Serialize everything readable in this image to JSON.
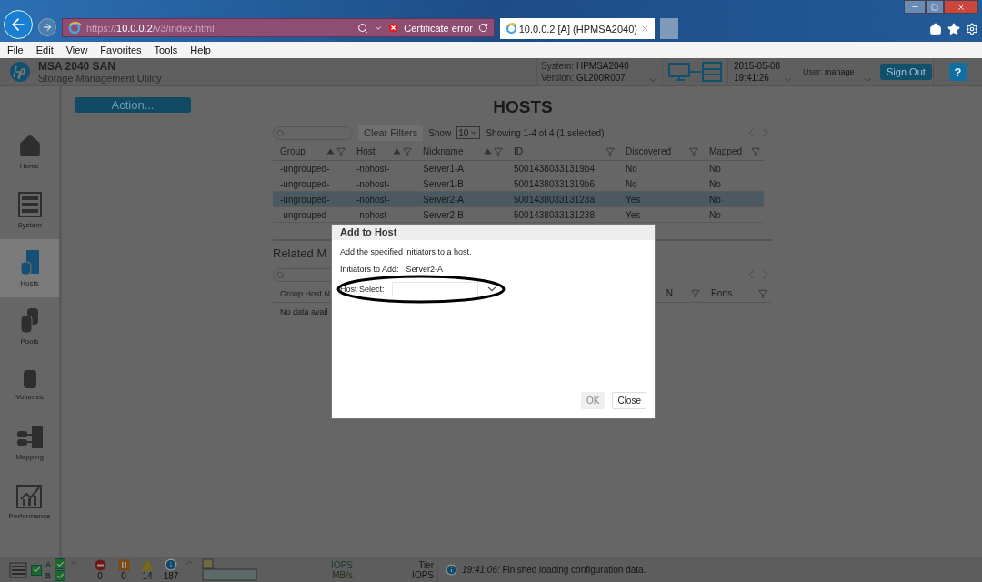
{
  "browser": {
    "address": {
      "scheme": "https://",
      "host": "10.0.0.2",
      "path": "/v3/index.html"
    },
    "certificate": "Certificate error",
    "tabs": [
      {
        "title": "10.0.0.2 [A] (HPMSA2040)",
        "selected": true
      }
    ]
  },
  "menu": [
    "File",
    "Edit",
    "View",
    "Favorites",
    "Tools",
    "Help"
  ],
  "header": {
    "product": "MSA 2040 SAN",
    "subtitle": "Storage Management Utility",
    "system_label": "System:",
    "system": "HPMSA2040",
    "version_label": "Version:",
    "version": "GL200R007",
    "date": "2015-05-08",
    "time": "19:41:26",
    "user_label": "User:",
    "user": "manage",
    "sign_out": "Sign Out",
    "help": "?"
  },
  "sidebar": [
    {
      "label": "Home",
      "selected": false
    },
    {
      "label": "System",
      "selected": false
    },
    {
      "label": "Hosts",
      "selected": true
    },
    {
      "label": "Pools",
      "selected": false
    },
    {
      "label": "Volumes",
      "selected": false
    },
    {
      "label": "Mapping",
      "selected": false
    },
    {
      "label": "Performance",
      "selected": false
    }
  ],
  "action": "Action...",
  "page_title": "HOSTS",
  "hosts_table": {
    "clear_filters": "Clear Filters",
    "show_label": "Show",
    "page_size": "10",
    "showing": "Showing 1-4 of 4 (1 selected)",
    "columns": [
      {
        "label": "Group",
        "sortable": true
      },
      {
        "label": "Host",
        "sortable": true
      },
      {
        "label": "Nickname",
        "sortable": true
      },
      {
        "label": "ID",
        "sortable": false
      },
      {
        "label": "Discovered",
        "sortable": false
      },
      {
        "label": "Mapped",
        "sortable": false
      }
    ],
    "rows": [
      {
        "cells": [
          "-ungrouped-",
          "-nohost-",
          "Server1-A",
          "50014380331319b4",
          "No",
          "No"
        ],
        "selected": false
      },
      {
        "cells": [
          "-ungrouped-",
          "-nohost-",
          "Server1-B",
          "50014380331319b6",
          "No",
          "No"
        ],
        "selected": false
      },
      {
        "cells": [
          "-ungrouped-",
          "-nohost-",
          "Server2-A",
          "500143803313123a",
          "Yes",
          "No"
        ],
        "selected": true
      },
      {
        "cells": [
          "-ungrouped-",
          "-nohost-",
          "Server2-B",
          "5001438033131238",
          "Yes",
          "No"
        ],
        "selected": false
      }
    ]
  },
  "related": {
    "title": "Related M",
    "columns": [
      {
        "label": "Group.Host.N"
      },
      {
        "label": "N"
      },
      {
        "label": "Ports"
      }
    ],
    "empty": "No data avail"
  },
  "dialog": {
    "title": "Add to Host",
    "description": "Add the specified initiators to a host.",
    "initiators_label": "Initiators to Add:",
    "initiators": "Server2-A",
    "host_select_label": "Host Select:",
    "ok": {
      "label": "OK",
      "disabled": true
    },
    "close": "Close"
  },
  "status_bar": {
    "controller_a": "A",
    "controller_b": "B",
    "counts": [
      {
        "kind": "error",
        "value": "0"
      },
      {
        "kind": "critical",
        "value": "0"
      },
      {
        "kind": "warning",
        "value": "14"
      },
      {
        "kind": "info",
        "value": "187"
      }
    ],
    "iops": "IOPS",
    "mbs": "MB/s",
    "tier": "Tier",
    "tier_iops": "IOPS",
    "message_time": "19:41:06:",
    "message": "Finished loading configuration data."
  }
}
